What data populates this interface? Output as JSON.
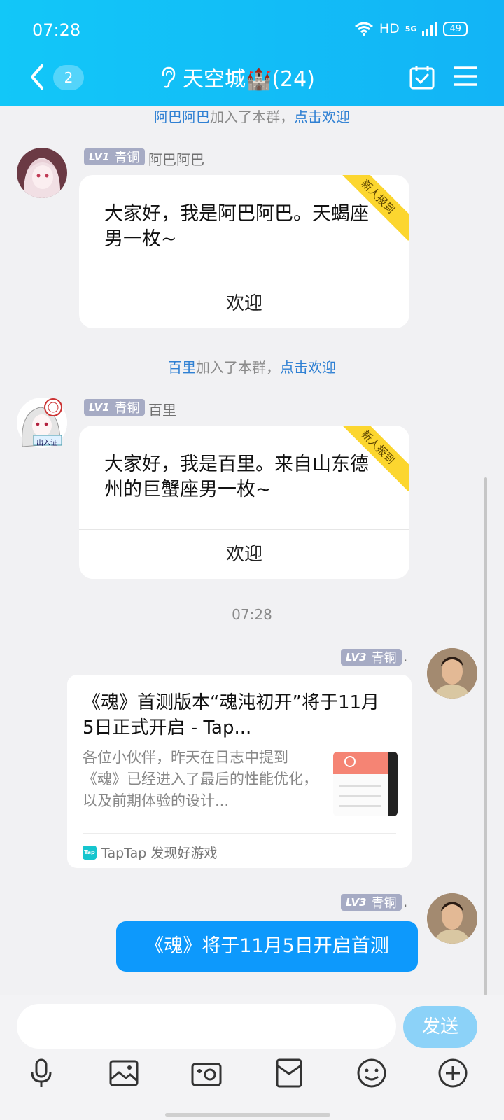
{
  "status": {
    "time": "07:28",
    "hd": "HD",
    "network": "5G",
    "battery": "49"
  },
  "header": {
    "unread_count": "2",
    "title": "天空城🏰(24)"
  },
  "timeline": {
    "join1": {
      "name": "阿巴阿巴",
      "text": "加入了本群，",
      "action": "点击欢迎"
    },
    "msg1": {
      "level": "LV1",
      "rank": "青铜",
      "nickname": "阿巴阿巴",
      "ribbon": "新人报到",
      "text": "大家好，我是阿巴阿巴。天蝎座男一枚~",
      "button": "欢迎"
    },
    "join2": {
      "name": "百里",
      "text": "加入了本群，",
      "action": "点击欢迎"
    },
    "msg2": {
      "level": "LV1",
      "rank": "青铜",
      "nickname": "百里",
      "avatar_tag": "出入证",
      "ribbon": "新人报到",
      "text": "大家好，我是百里。来自山东德州的巨蟹座男一枚~",
      "button": "欢迎"
    },
    "time_divider": "07:28",
    "msg3": {
      "level": "LV3",
      "rank": "青铜",
      "nickname": ".",
      "share_title": "《魂》首测版本“魂沌初开”将于11月5日正式开启 - Tap...",
      "share_desc": "各位小伙伴，昨天在日志中提到《魂》已经进入了最后的性能优化，以及前期体验的设计...",
      "source_logo": "Tap",
      "source": "TapTap 发现好游戏"
    },
    "msg4": {
      "level": "LV3",
      "rank": "青铜",
      "nickname": ".",
      "text": "《魂》将于11月5日开启首测"
    }
  },
  "composer": {
    "placeholder": "",
    "send_label": "发送"
  },
  "toolbar": [
    "mic-icon",
    "image-icon",
    "camera-icon",
    "red-packet-icon",
    "emoji-icon",
    "plus-icon"
  ],
  "colors": {
    "header": "#12c7f8",
    "bubble": "#0d99fc",
    "link": "#2f80d3",
    "badge": "#a6abc4",
    "ribbon": "#fcd62f"
  }
}
